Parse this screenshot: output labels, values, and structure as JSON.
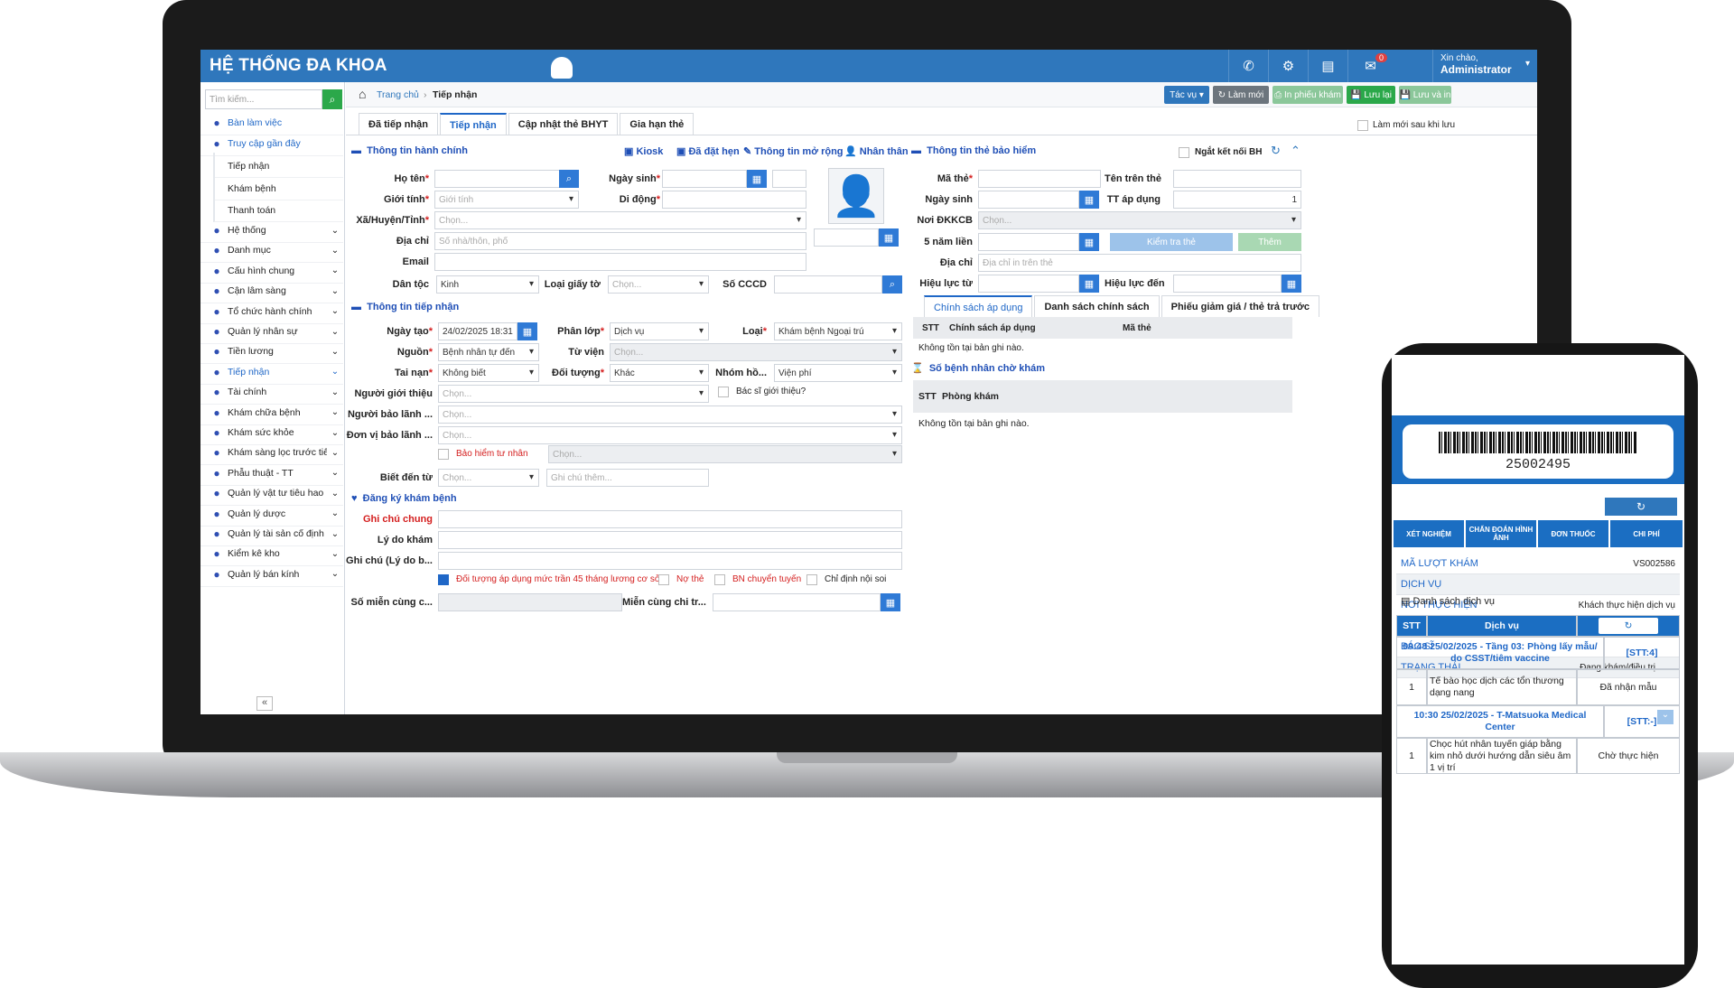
{
  "app": {
    "title": "HỆ THỐNG ĐA KHOA",
    "user_greeting": "Xin chào,",
    "user_name": "Administrator",
    "mail_badge": "0"
  },
  "colors": {
    "primary": "#2f77bc",
    "accent_green": "#2ba84a",
    "link": "#1f4fb6",
    "required": "#d41e1e"
  },
  "sidebar": {
    "search_placeholder": "Tìm kiếm...",
    "items": [
      {
        "label": "Bàn làm việc",
        "icon": "briefcase-icon"
      },
      {
        "label": "Truy cập gần đây",
        "icon": "users-icon"
      },
      {
        "label": "Hệ thống",
        "icon": "group-icon"
      },
      {
        "label": "Danh mục",
        "icon": "list-icon"
      },
      {
        "label": "Cấu hình chung",
        "icon": "cogs-icon"
      },
      {
        "label": "Cận lâm sàng",
        "icon": "lab-icon"
      },
      {
        "label": "Tổ chức hành chính",
        "icon": "sitemap-icon"
      },
      {
        "label": "Quản lý nhân sự",
        "icon": "staff-icon"
      },
      {
        "label": "Tiền lương",
        "icon": "money-icon"
      },
      {
        "label": "Tiếp nhận",
        "icon": "reception-icon"
      },
      {
        "label": "Tài chính",
        "icon": "finance-icon"
      },
      {
        "label": "Khám chữa bệnh",
        "icon": "medkit-icon"
      },
      {
        "label": "Khám sức khỏe",
        "icon": "health-icon"
      },
      {
        "label": "Khám sàng lọc trước tiêm",
        "icon": "screening-icon"
      },
      {
        "label": "Phẫu thuật - TT",
        "icon": "scissors-icon"
      },
      {
        "label": "Quản lý vật tư tiêu hao",
        "icon": "syringe-icon"
      },
      {
        "label": "Quản lý dược",
        "icon": "pills-icon"
      },
      {
        "label": "Quản lý tài sản cố định",
        "icon": "assets-icon"
      },
      {
        "label": "Kiểm kê kho",
        "icon": "truck-icon"
      },
      {
        "label": "Quản lý bán kính",
        "icon": "glasses-icon"
      }
    ],
    "recent": [
      "Tiếp nhận",
      "Khám bệnh",
      "Thanh toán"
    ],
    "collapse": "«"
  },
  "breadcrumb": {
    "home": "Trang chủ",
    "current": "Tiếp nhận"
  },
  "actions": {
    "task": "Tác vụ",
    "refresh": "Làm mới",
    "print": "In phiếu khám",
    "save": "Lưu lại",
    "save_print": "Lưu và in"
  },
  "tabs": [
    "Đã tiếp nhận",
    "Tiếp nhận",
    "Cập nhật thẻ BHYT",
    "Gia hạn thẻ"
  ],
  "new_after_save": "Làm mới sau khi lưu",
  "admin": {
    "title": "Thông tin hành chính",
    "links": {
      "kiosk": "Kiosk",
      "booked": "Đã đặt hẹn",
      "extended": "Thông tin mở rộng",
      "relatives": "Nhân thân"
    },
    "name": "Họ tên",
    "dob": "Ngày sinh",
    "gender": "Giới tính",
    "gender_ph": "Giới tính",
    "mobile": "Di động",
    "ward": "Xã/Huyện/Tỉnh",
    "choose": "Chọn...",
    "address": "Địa chỉ",
    "address_ph": "Số nhà/thôn, phố",
    "email": "Email",
    "ethnic": "Dân tộc",
    "ethnic_val": "Kinh",
    "paper_type": "Loại giấy tờ",
    "cccd": "Số CCCD"
  },
  "reception": {
    "title": "Thông tin tiếp nhận",
    "created": "Ngày tạo",
    "created_val": "24/02/2025 18:31",
    "tier": "Phân lớp",
    "tier_val": "Dịch vụ",
    "type": "Loại",
    "type_val": "Khám bệnh Ngoại trú",
    "source": "Nguồn",
    "source_val": "Bệnh nhân tự đến",
    "from_hospital": "Từ viện",
    "accident": "Tai nạn",
    "accident_val": "Không biết",
    "subject": "Đối tượng",
    "subject_val": "Khác",
    "group": "Nhóm hồ...",
    "group_val": "Viện phí",
    "referrer": "Người giới thiệu",
    "ref_doctor": "Bác sĩ giới thiệu?",
    "guarantor": "Người bảo lãnh ...",
    "guarantor_unit": "Đơn vị bảo lãnh ...",
    "private_ins": "Bảo hiểm tư nhân",
    "knew_from": "Biết đến từ",
    "note_ph": "Ghi chú thêm..."
  },
  "exam": {
    "title": "Đăng ký khám bệnh",
    "common_note": "Ghi chú chung",
    "reason": "Lý do khám",
    "note2": "Ghi chú (Lý do b...",
    "chk_45": "Đối tượng áp dụng mức trần 45 tháng lương cơ sở",
    "chk_debt": "Nợ thẻ",
    "chk_transfer": "BN chuyển tuyến",
    "chk_endo": "Chỉ định nội soi",
    "exempt": "Số miễn cùng c...",
    "exempt_to": "Miễn cùng chi tr..."
  },
  "insurance": {
    "title": "Thông tin thẻ bảo hiểm",
    "disconnect": "Ngắt kết nối BH",
    "card_no": "Mã thẻ",
    "card_name": "Tên trên thẻ",
    "dob": "Ngày sinh",
    "tt": "TT áp dụng",
    "tt_val": "1",
    "reg_place": "Nơi ĐKKCB",
    "choose": "Chọn...",
    "five_years": "5 năm liền",
    "check_card": "Kiểm tra thẻ",
    "add": "Thêm",
    "address": "Địa chỉ",
    "address_ph": "Địa chỉ in trên thẻ",
    "valid_from": "Hiệu lực từ",
    "valid_to": "Hiệu lực đến"
  },
  "policy_tabs": [
    "Chính sách áp dụng",
    "Danh sách chính sách",
    "Phiếu giảm giá / thẻ trả trước"
  ],
  "policy_table": {
    "headers": [
      "STT",
      "Chính sách áp dụng",
      "Mã thẻ"
    ],
    "empty": "Không tồn tại bản ghi nào."
  },
  "waiting": {
    "title": "Số bệnh nhân chờ khám",
    "headers": [
      "STT",
      "Phòng khám"
    ],
    "empty": "Không tồn tại bản ghi nào."
  },
  "phone": {
    "barcode": "25002495",
    "tabs": [
      "XÉT NGHIỆM",
      "CHẨN ĐOÁN HÌNH ẢNH",
      "ĐƠN THUỐC",
      "CHI PHÍ"
    ],
    "rows": [
      {
        "k": "Mã lượt khám",
        "v": "VS002586"
      },
      {
        "k": "Dịch vụ",
        "v": ""
      },
      {
        "k": "Nơi thực hiện",
        "v": "Khách thực hiện dịch vụ"
      },
      {
        "k": "STT",
        "v": "-"
      },
      {
        "k": "Bác sĩ",
        "v": ""
      },
      {
        "k": "Trạng thái",
        "v": "Đang khám/điều trị"
      }
    ],
    "service_list": "Danh sách dịch vụ",
    "headers": [
      "STT",
      "Dịch vụ"
    ],
    "groups": [
      {
        "title": "09:48 25/02/2025 - Tầng 03: Phòng lấy mẫu/ do CSST/tiêm vaccine",
        "stt": "[STT:4]",
        "row": {
          "no": "1",
          "name": "Tế bào học dịch các tổn thương dạng nang",
          "status": "Đã nhận mẫu"
        }
      },
      {
        "title": "10:30 25/02/2025 - T-Matsuoka Medical Center",
        "stt": "[STT:-]",
        "row": {
          "no": "1",
          "name": "Chọc hút nhân tuyến giáp bằng kim nhỏ dưới hướng dẫn siêu âm 1 vị trí",
          "status": "Chờ thực hiện"
        }
      }
    ]
  }
}
